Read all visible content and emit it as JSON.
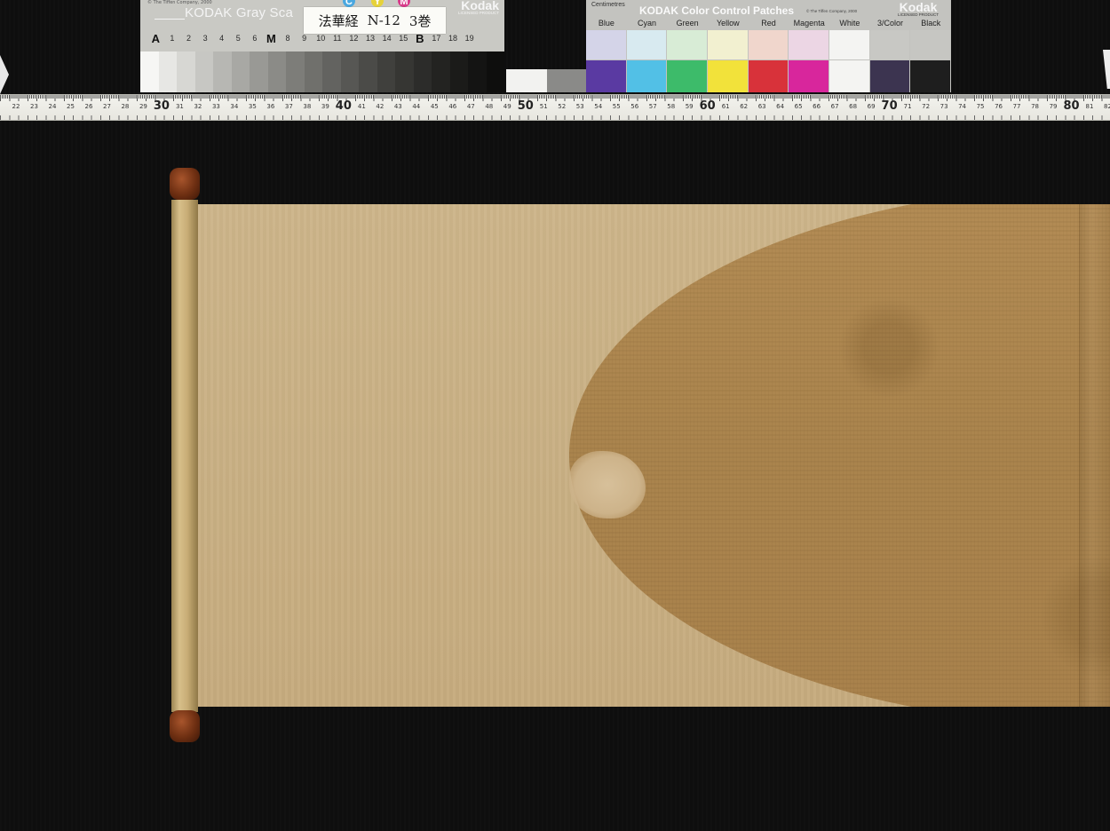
{
  "gray_scale_card": {
    "copyright": "© The Tiffen Company, 2000",
    "title": "KODAK Gray Sca",
    "label_title": "法華経",
    "label_code": "N-12",
    "label_volume": "3巻",
    "cym_letters": [
      "C",
      "Y",
      "M"
    ],
    "brand": "Kodak",
    "brand_sub": "LICENSED PRODUCT",
    "step_labels": [
      "A",
      "1",
      "2",
      "3",
      "4",
      "5",
      "6",
      "M",
      "8",
      "9",
      "10",
      "11",
      "12",
      "13",
      "14",
      "15",
      "B",
      "17",
      "18",
      "19"
    ],
    "patch_colors": [
      "#f6f6f4",
      "#e7e7e4",
      "#d7d7d3",
      "#c7c7c3",
      "#b7b7b3",
      "#a8a8a4",
      "#999995",
      "#8b8b87",
      "#7d7d79",
      "#70706c",
      "#636360",
      "#575754",
      "#4b4b48",
      "#40403d",
      "#363633",
      "#2c2c2a",
      "#232321",
      "#1b1b19",
      "#141413",
      "#0e0e0d"
    ]
  },
  "color_card": {
    "unit_label": "Centimetres",
    "title": "KODAK Color Control Patches",
    "copyright": "© The Tiffen Company, 2000",
    "brand": "Kodak",
    "brand_sub": "LICENSED PRODUCT",
    "patch_names": [
      "Blue",
      "Cyan",
      "Green",
      "Yellow",
      "Red",
      "Magenta",
      "White",
      "3/Color",
      "Black"
    ],
    "top_colors": [
      "#d4d4e8",
      "#d8eaf0",
      "#d8ecd6",
      "#f2f0d0",
      "#f0d6cc",
      "#ecd6e4",
      "#f4f4f2",
      "#c8c8c4",
      "#c6c6c2"
    ],
    "bottom_colors": [
      "#5a3aa2",
      "#52c0e6",
      "#3dbb6a",
      "#f2e23a",
      "#d8323a",
      "#d8269c",
      "#f4f4f2",
      "#3c3450",
      "#1e1e1e"
    ]
  },
  "ruler": {
    "start": 22,
    "end": 82,
    "labels": [
      "22",
      "23",
      "24",
      "25",
      "26",
      "27",
      "28",
      "29",
      "30",
      "31",
      "32",
      "33",
      "34",
      "35",
      "36",
      "37",
      "38",
      "39",
      "40",
      "41",
      "42",
      "43",
      "44",
      "45",
      "46",
      "47",
      "48",
      "49",
      "50",
      "51",
      "52",
      "53",
      "54",
      "55",
      "56",
      "57",
      "58",
      "59",
      "60",
      "61",
      "62",
      "63",
      "64",
      "65",
      "66",
      "67",
      "68",
      "69",
      "70",
      "71",
      "72",
      "73",
      "74",
      "75",
      "76",
      "77",
      "78",
      "79",
      "80",
      "81",
      "82"
    ]
  },
  "colors": {
    "background": "#0e0e0e",
    "paper": "#c9b084",
    "silk_panel": "#aa844d",
    "roller_cap": "#6e2f12",
    "roller_rod": "#c8ad76"
  }
}
